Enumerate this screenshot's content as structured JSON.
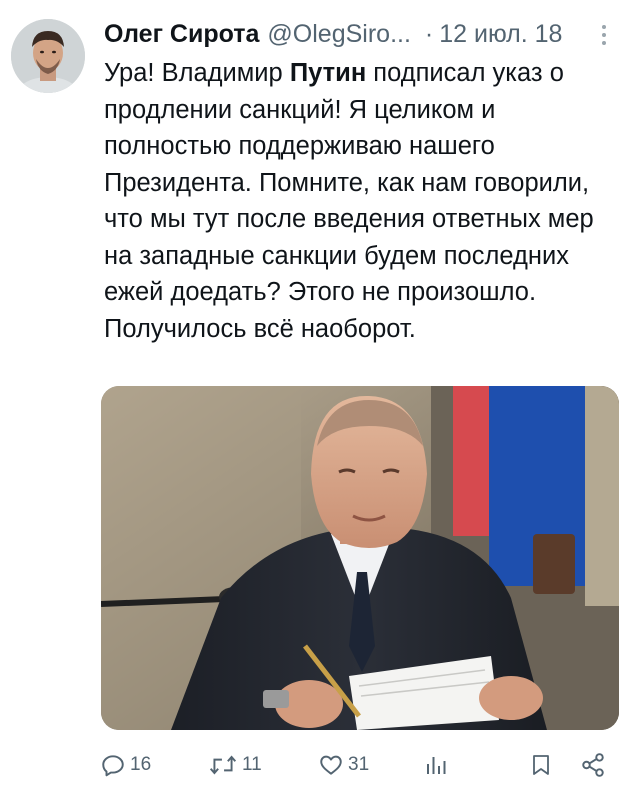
{
  "author": {
    "display_name": "Олег Сирота",
    "handle": "@OlegSiro...",
    "separator": "·",
    "date": "12 июл. 18",
    "avatar_icon": "avatar-photo"
  },
  "tweet": {
    "text_before_bold": "Ура! Владимир ",
    "text_bold": "Путин",
    "text_after_bold": " подписал указ о продлении санкций!  Я целиком и полностью поддерживаю нашего Президента. Помните, как нам говорили, что мы тут после введения ответных мер на западные санкции будем последних ежей доедать? Этого не произошло. Получилось всё наоборот."
  },
  "actions": {
    "reply": {
      "icon": "reply-icon",
      "count": "16"
    },
    "retweet": {
      "icon": "retweet-icon",
      "count": "11"
    },
    "like": {
      "icon": "like-icon",
      "count": "31"
    },
    "views": {
      "icon": "views-icon"
    },
    "bookmark": {
      "icon": "bookmark-icon"
    },
    "share": {
      "icon": "share-icon"
    }
  },
  "colors": {
    "text_primary": "#0f1419",
    "text_secondary": "#536471",
    "background": "#ffffff"
  }
}
